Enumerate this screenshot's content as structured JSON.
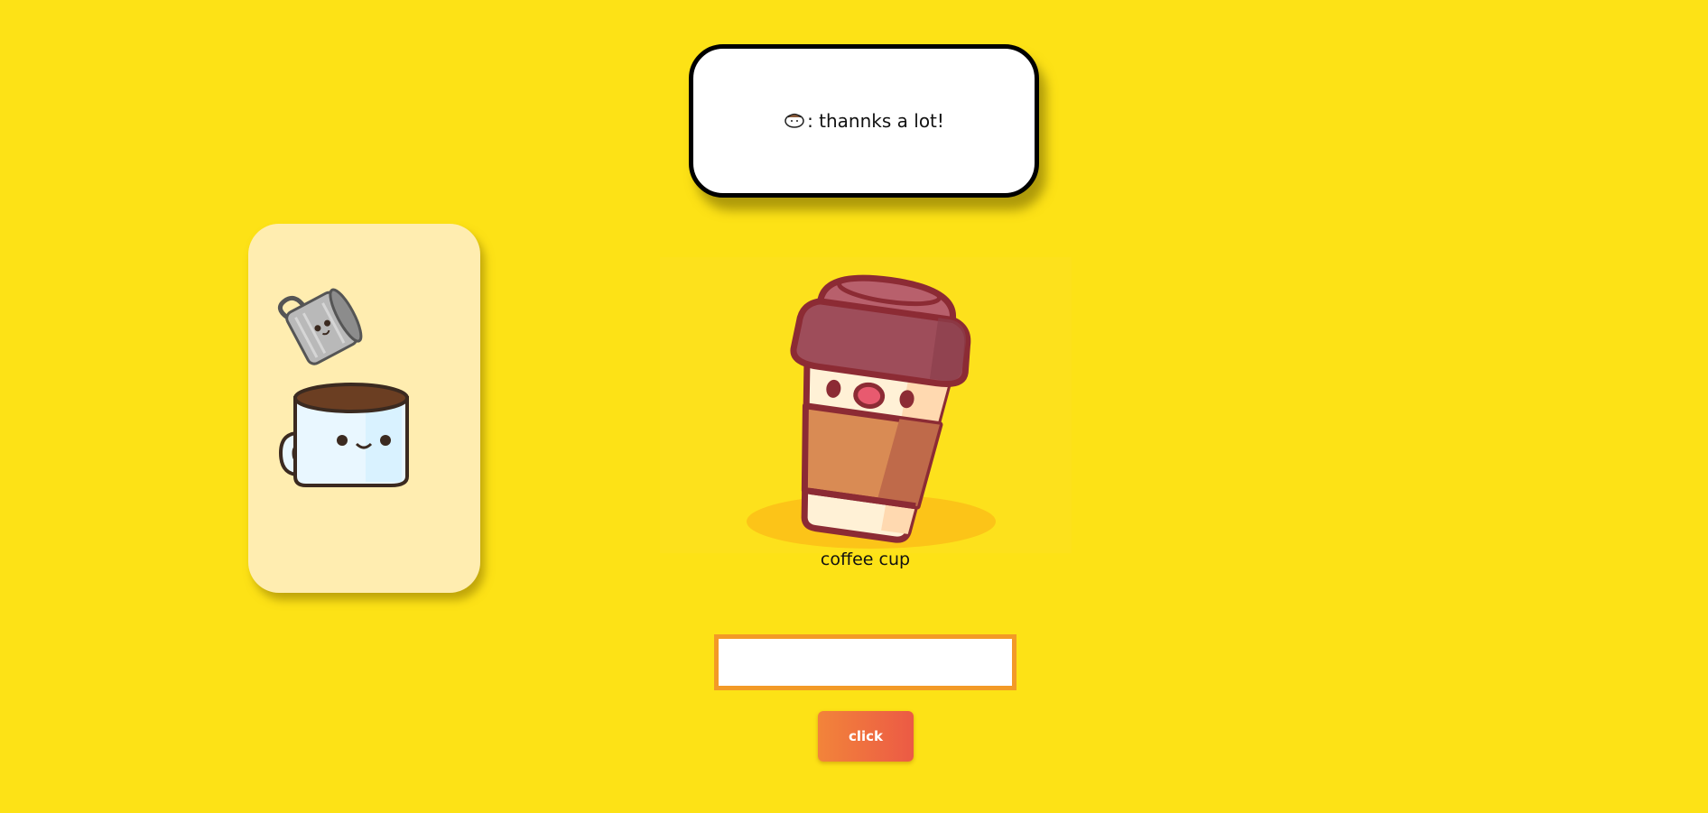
{
  "speech": {
    "icon": "coffee-cup-icon",
    "text": ": thannks a lot!"
  },
  "side_card": {
    "images": [
      "pouring-jug-icon",
      "coffee-mug-icon"
    ]
  },
  "main": {
    "image": "takeaway-coffee-cup-image",
    "caption": "coffee cup"
  },
  "answer": {
    "value": "",
    "placeholder": ""
  },
  "submit": {
    "label": "click"
  },
  "colors": {
    "background": "#fde216",
    "card": "#ffedb0",
    "input_border": "#f39a26",
    "button_start": "#f2843a",
    "button_end": "#ec5a45"
  }
}
